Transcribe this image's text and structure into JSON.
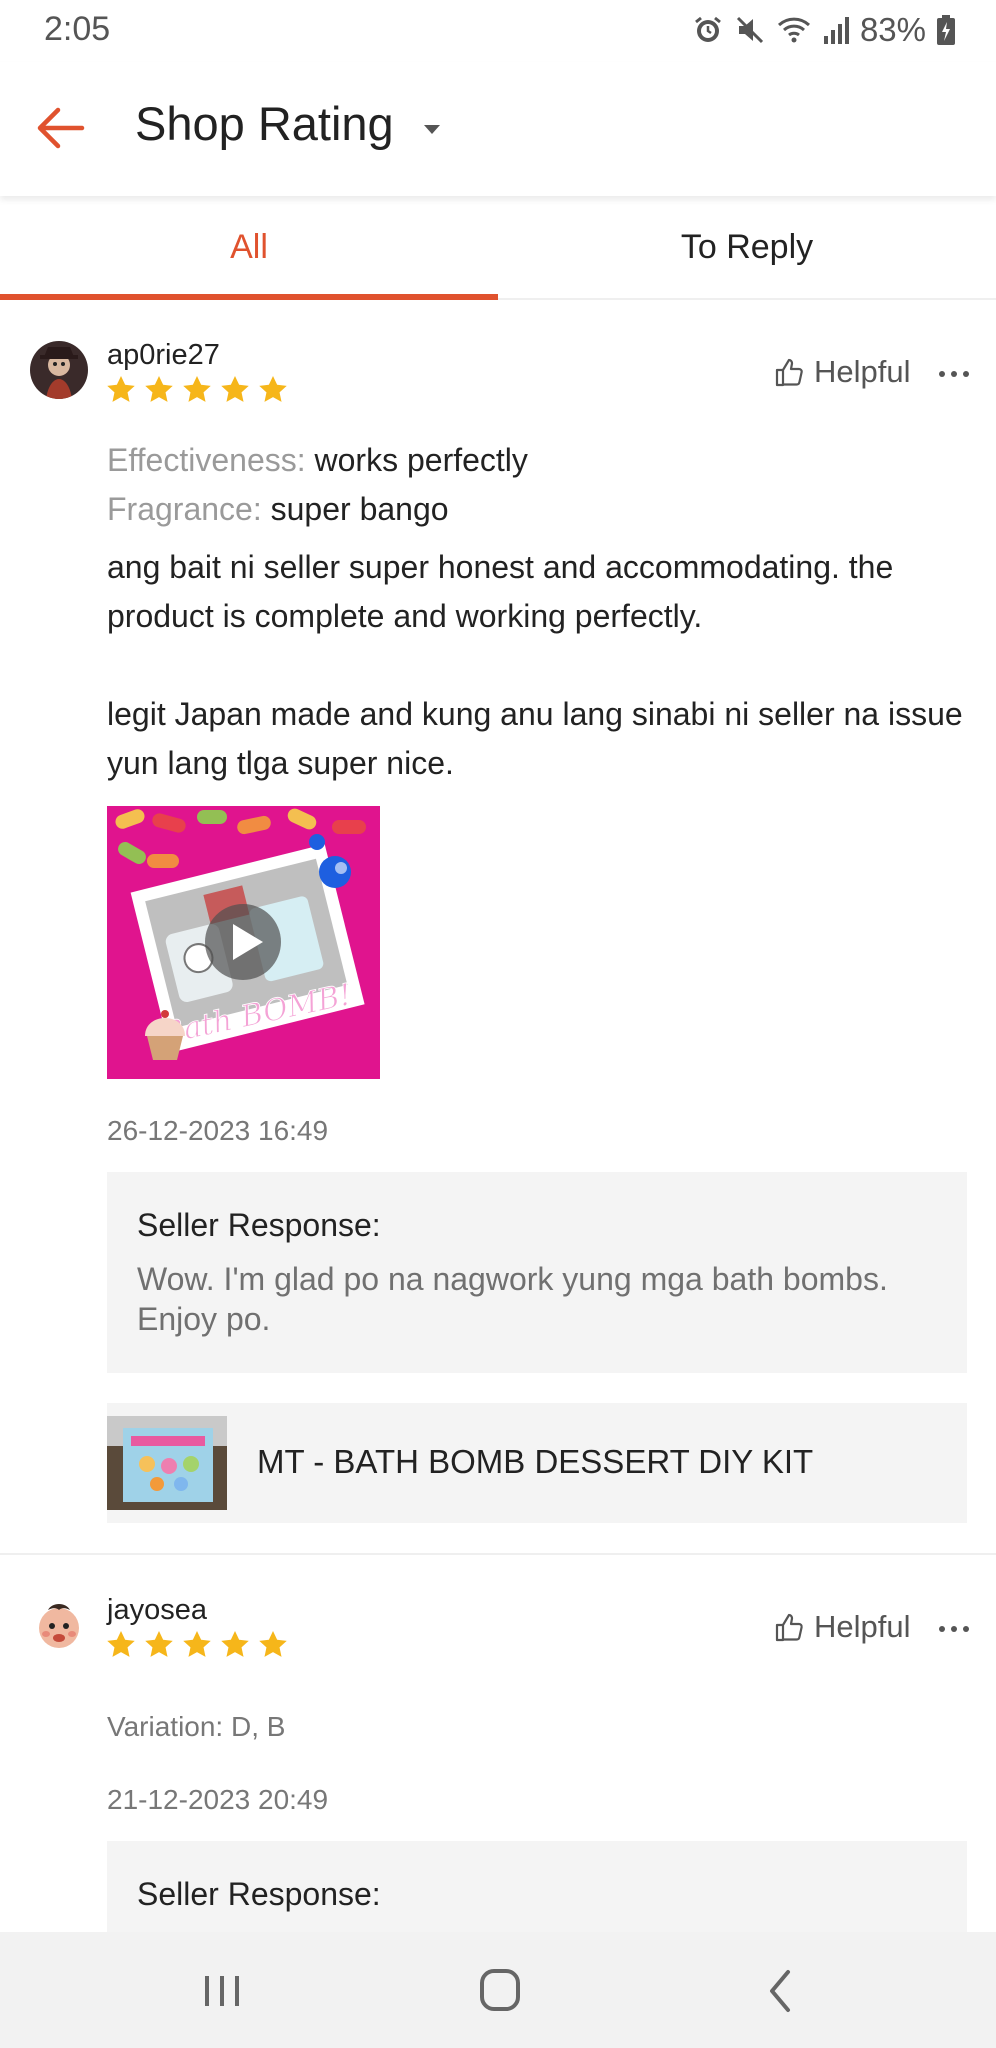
{
  "status_bar": {
    "time": "2:05",
    "battery": "83%",
    "icons": [
      "alarm-icon",
      "mute-icon",
      "wifi-icon",
      "signal-icon",
      "battery-icon"
    ]
  },
  "header": {
    "title": "Shop Rating",
    "back_icon": "arrow-left-icon",
    "dropdown_icon": "caret-down-icon",
    "accent_color": "#e0522e"
  },
  "tabs": [
    {
      "label": "All",
      "active": true
    },
    {
      "label": "To Reply",
      "active": false
    }
  ],
  "reviews": [
    {
      "username": "ap0rie27",
      "rating": 5,
      "helpful_label": "Helpful",
      "attributes": [
        {
          "key": "Effectiveness:",
          "value": "works perfectly"
        },
        {
          "key": "Fragrance:",
          "value": "super bango"
        }
      ],
      "paragraphs": [
        "ang bait ni seller super honest and accommodating. the product is complete and working perfectly.",
        "legit Japan made and kung anu lang sinabi ni seller na issue yun lang tlga super nice."
      ],
      "media_caption": "Bath BOMB!",
      "date": "26-12-2023 16:49",
      "seller_response_label": "Seller Response:",
      "seller_response": "Wow. I'm glad po na nagwork yung mga bath bombs. Enjoy po.",
      "product_name": "MT - BATH BOMB DESSERT DIY KIT"
    },
    {
      "username": "jayosea",
      "rating": 5,
      "helpful_label": "Helpful",
      "variation": "Variation: D, B",
      "date": "21-12-2023 20:49",
      "seller_response_label": "Seller Response:"
    }
  ],
  "nav_bar": {
    "buttons": [
      "recent-apps-icon",
      "home-icon",
      "back-icon"
    ]
  },
  "colors": {
    "star": "#f6b61a",
    "accent": "#e0522e",
    "card_bg": "#f4f4f4"
  }
}
